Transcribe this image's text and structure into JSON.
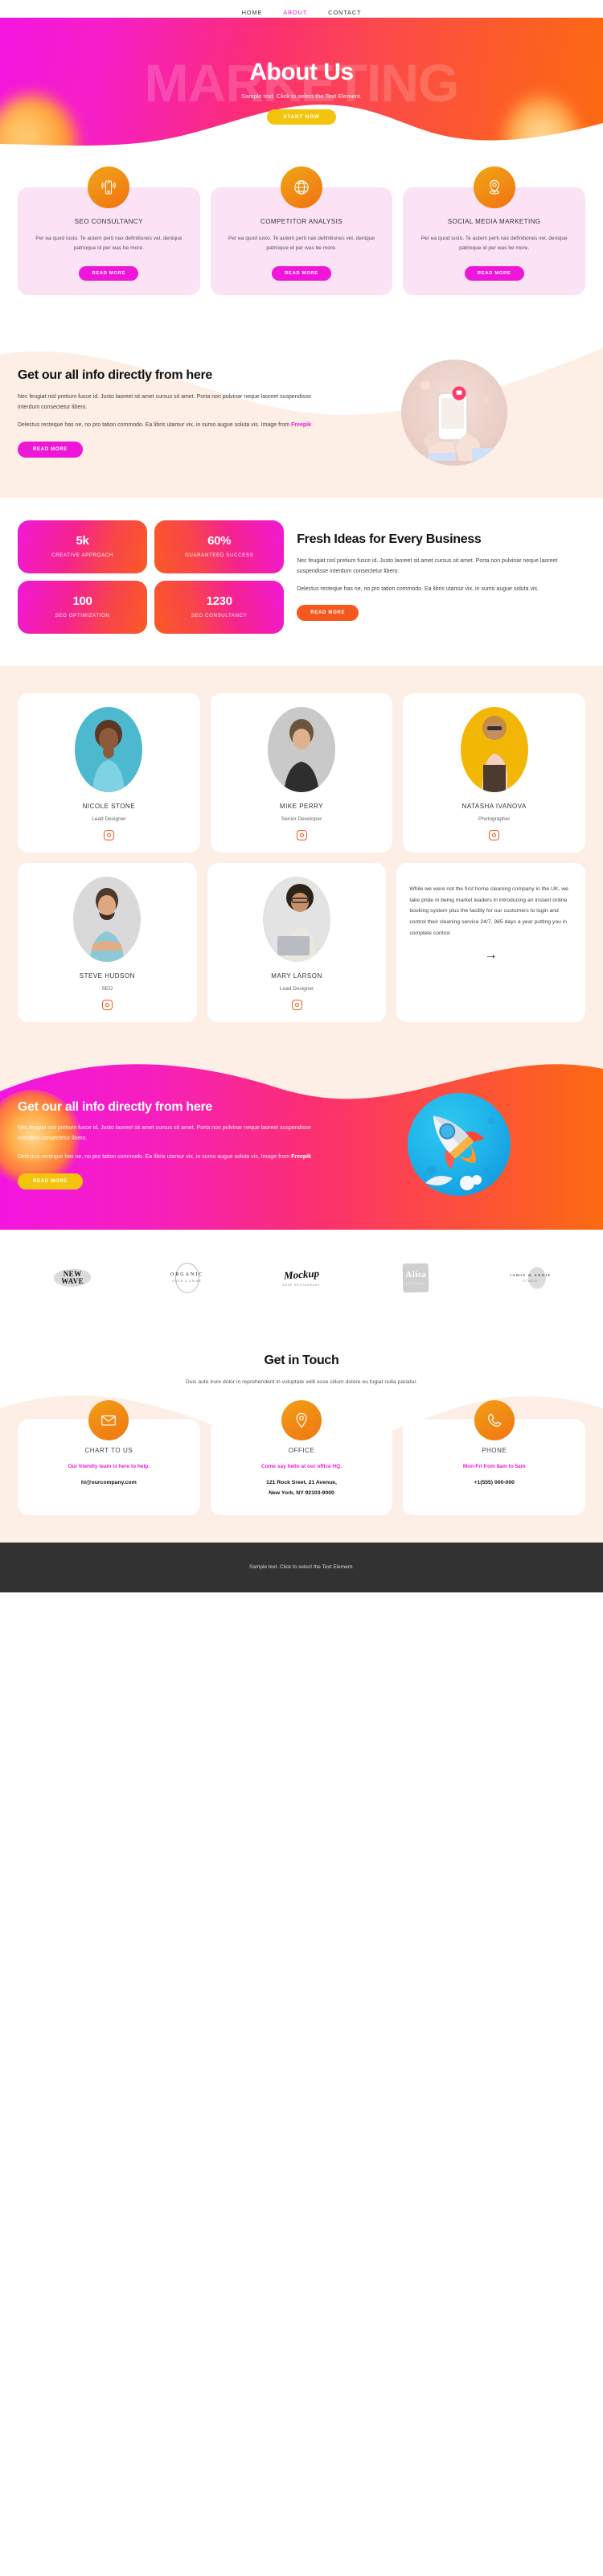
{
  "nav": {
    "items": [
      {
        "label": "HOME",
        "active": false
      },
      {
        "label": "ABOUT",
        "active": true
      },
      {
        "label": "CONTACT",
        "active": false
      }
    ]
  },
  "hero": {
    "ghost_word": "MARKETING",
    "title": "About Us",
    "subtitle": "Sample text. Click to select the Text Element.",
    "cta_label": "START NOW",
    "cta_color": "#f2c50c"
  },
  "services": {
    "cards": [
      {
        "icon": "mobile-signal-icon",
        "title": "SEO CONSULTANCY",
        "body": "Per ea quod iusto. Te autem perti nax definitiones vel, denique patrioque id per was be more.",
        "button": "READ MORE"
      },
      {
        "icon": "globe-icon",
        "title": "COMPETITOR ANALYSIS",
        "body": "Per ea quod iusto. Te autem perti nax definitiones vel, denique patrioque id per was be more.",
        "button": "READ MORE"
      },
      {
        "icon": "map-pin-icon",
        "title": "SOCIAL MEDIA MARKETING",
        "body": "Per ea quod iusto. Te autem perti nax definitiones vel, denique patrioque id per was be more.",
        "button": "READ MORE"
      }
    ]
  },
  "info": {
    "heading": "Get our all info directly from here",
    "paragraph1": "Nec feugiat nisl pretium fusce id. Justo laoreet sit amet cursus sit amet. Porta non pulvinar neque laoreet suspendisse interdum consectetur libero.",
    "paragraph2_pre": "Delectus recteque has ne, no pro tation commodo. Ea libris utamur vix, in sumo augue soluta vis. Image from ",
    "paragraph2_link": "Freepik",
    "button": "READ MORE",
    "illustration": "hand-holding-smartphone-illustration"
  },
  "stats": {
    "cards": [
      {
        "number": "5k",
        "label": "CREATIVE APPROACH"
      },
      {
        "number": "60%",
        "label": "GUARANTEED SUCCESS"
      },
      {
        "number": "100",
        "label": "SEO OPTIMIZATION"
      },
      {
        "number": "1230",
        "label": "SEO CONSULTANCY"
      }
    ],
    "heading": "Fresh Ideas for Every Business",
    "paragraph1": "Nec feugiat nisl pretium fusce id. Justo laoreet sit amet cursus sit amet. Porta non pulvinar neque laoreet suspendisse interdum consectetur libero.",
    "paragraph2": "Delectus recteque has ne, no pro tation commodo. Ea libris utamur vix, in sumo augue soluta vis.",
    "button": "READ MORE",
    "button_color": "#f4581d"
  },
  "team": {
    "row1": [
      {
        "name": "NICOLE STONE",
        "role": "Lead Designer",
        "photo_bg": "#4db9cf",
        "social": "instagram-icon"
      },
      {
        "name": "MIKE PERRY",
        "role": "Senior Developer",
        "photo_bg": "#c9c9c9",
        "social": "instagram-icon"
      },
      {
        "name": "NATASHA IVANOVA",
        "role": "Photographer",
        "photo_bg": "#f2b705",
        "social": "instagram-icon"
      }
    ],
    "row2": [
      {
        "name": "STEVE HUDSON",
        "role": "SEO",
        "photo_bg": "#d9d9d9",
        "social": "instagram-icon"
      },
      {
        "name": "MARY LARSON",
        "role": "Lead Designer",
        "photo_bg": "#e3e3e3",
        "social": "instagram-icon"
      }
    ],
    "quote": "While we were not the first home cleaning company in the UK, we take pride in being market leaders in introducing an instant online booking system plus the facility for our customers to login and control their cleaning service 24/7, 365 days a year putting you in complete control.",
    "quote_arrow": "→"
  },
  "cta": {
    "heading": "Get our all info directly from here",
    "paragraph1": "Nec feugiat nisl pretium fusce id. Justo laoreet sit amet cursus sit amet. Porta non pulvinar neque laoreet suspendisse interdum consectetur libero.",
    "paragraph2_pre": "Delectus recteque has ne, no pro tation commodo. Ea libris utamur vix, in sumo augue soluta vis. Image from ",
    "paragraph2_link": "Freepik",
    "button": "READ MORE",
    "button_color": "#f2c50c",
    "illustration": "rocket-illustration"
  },
  "logos": [
    {
      "line1": "NEW",
      "line2": "WAVE",
      "sub": "",
      "style": "smear"
    },
    {
      "line1": "ORGANIC",
      "line2": "",
      "sub": "FOOD & DRINK",
      "style": "ring"
    },
    {
      "line1": "Mockup",
      "line2": "",
      "sub": "BAKE RESTAURANT",
      "style": "script"
    },
    {
      "line1": "Alisa",
      "line2": "",
      "sub": "BOUTIQUE",
      "style": "box"
    },
    {
      "line1": "JAMIE & ANNIE",
      "line2": "",
      "sub": "STUDIO",
      "style": "ell"
    }
  ],
  "contact": {
    "heading": "Get in Touch",
    "subheading": "Duis aute irure dolor in reprehenderit in voluptate velit esse cillum dolore eu fugiat nulla pariatur.",
    "cards": [
      {
        "icon": "envelope-icon",
        "title": "CHART TO US",
        "tagline": "Our friendly team is here to help.",
        "value": "hi@ourcompany.com"
      },
      {
        "icon": "map-pin-icon",
        "title": "OFFICE",
        "tagline": "Come say hello at our office HQ.",
        "value": "121 Rock Sreet, 21 Avenue,\nNew York, NY 92103-9000"
      },
      {
        "icon": "phone-icon",
        "title": "PHONE",
        "tagline": "Mon-Fri from 8am to 5am",
        "value": "+1(555) 000-000"
      }
    ]
  },
  "footer": {
    "text": "Sample text. Click to select the Text Element."
  }
}
